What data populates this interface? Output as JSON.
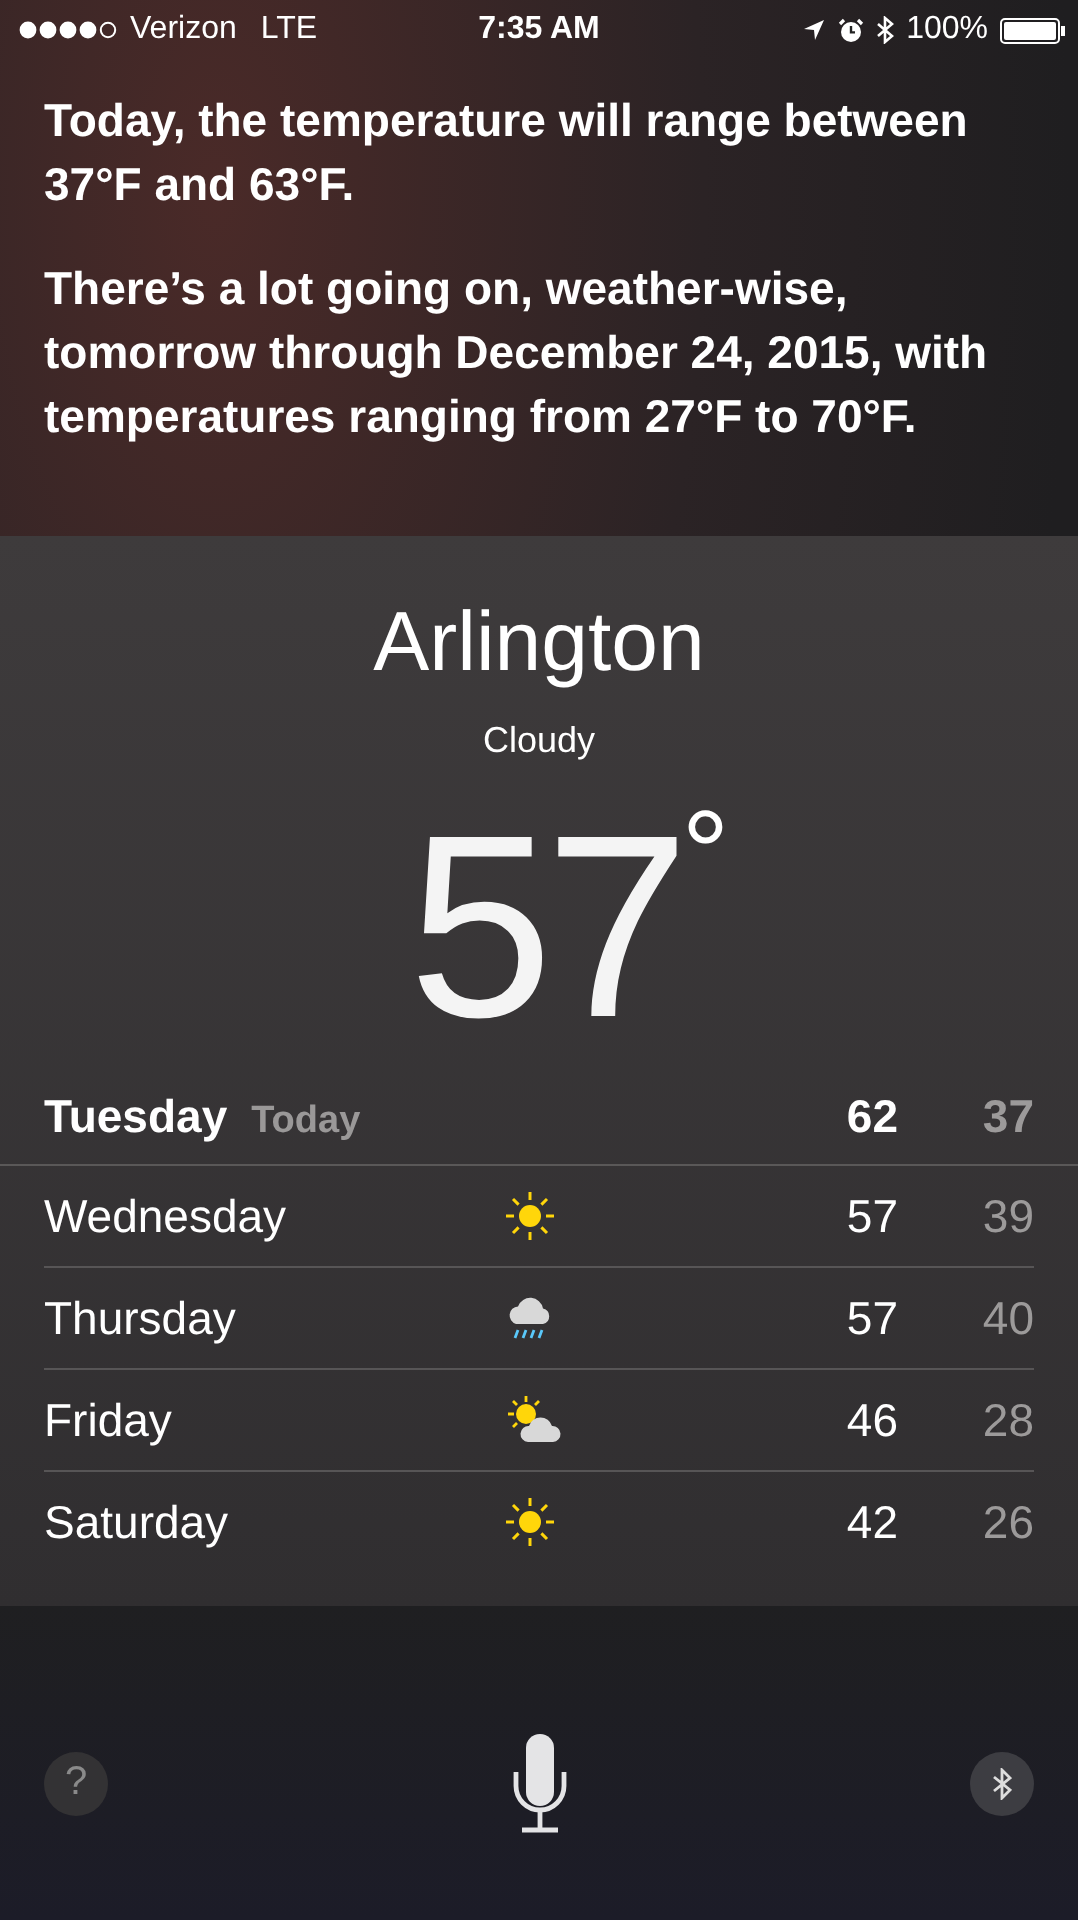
{
  "status_bar": {
    "carrier": "Verizon",
    "network": "LTE",
    "time": "7:35 AM",
    "battery": "100%"
  },
  "siri_response": [
    "Today, the temperature will range between 37°F and 63°F.",
    "There’s a lot going on, weather-wise, tomorrow through December 24, 2015, with temperatures ranging from 27°F to 70°F."
  ],
  "weather": {
    "city": "Arlington",
    "condition": "Cloudy",
    "temperature": "57",
    "degree": "°",
    "today": {
      "day": "Tuesday",
      "label": "Today",
      "high": "62",
      "low": "37"
    },
    "forecast": [
      {
        "day": "Wednesday",
        "kind": "sunny",
        "high": "57",
        "low": "39"
      },
      {
        "day": "Thursday",
        "kind": "rain",
        "high": "57",
        "low": "40"
      },
      {
        "day": "Friday",
        "kind": "partly-cloudy",
        "high": "46",
        "low": "28"
      },
      {
        "day": "Saturday",
        "kind": "sunny",
        "high": "42",
        "low": "26"
      }
    ]
  },
  "bottom_bar": {
    "help": "?"
  }
}
